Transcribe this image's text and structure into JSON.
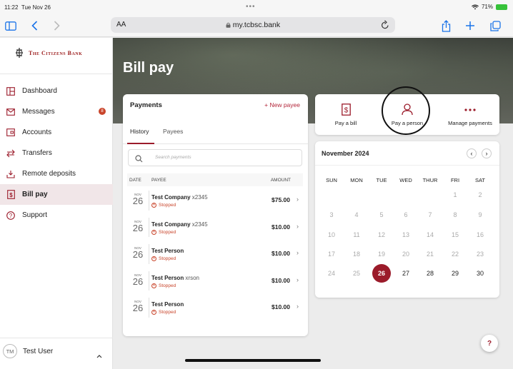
{
  "status": {
    "time": "11:22",
    "date": "Tue Nov 26",
    "battery": "71%"
  },
  "browser": {
    "text_size": "AA",
    "url": "my.tcbsc.bank"
  },
  "bank": {
    "name": "The Citizens Bank"
  },
  "sidebar": {
    "items": [
      {
        "label": "Dashboard",
        "icon": "dashboard-icon"
      },
      {
        "label": "Messages",
        "icon": "envelope-icon",
        "badge": "8"
      },
      {
        "label": "Accounts",
        "icon": "accounts-icon"
      },
      {
        "label": "Transfers",
        "icon": "transfer-icon"
      },
      {
        "label": "Remote deposits",
        "icon": "deposit-icon"
      },
      {
        "label": "Bill pay",
        "icon": "dollar-doc-icon",
        "active": true
      },
      {
        "label": "Support",
        "icon": "question-circle-icon"
      }
    ],
    "user": {
      "initials": "TM",
      "name": "Test User"
    }
  },
  "page": {
    "title": "Bill pay"
  },
  "payments": {
    "title": "Payments",
    "new_payee": "+ New payee",
    "tabs": [
      "History",
      "Payees"
    ],
    "search_placeholder": "Search payments",
    "columns": {
      "date": "DATE",
      "payee": "PAYEE",
      "amount": "AMOUNT"
    },
    "rows": [
      {
        "mon": "NOV",
        "day": "26",
        "payee": "Test Company",
        "suffix": " x2345",
        "status": "Stopped",
        "amount": "$75.00"
      },
      {
        "mon": "NOV",
        "day": "26",
        "payee": "Test Company",
        "suffix": " x2345",
        "status": "Stopped",
        "amount": "$10.00"
      },
      {
        "mon": "NOV",
        "day": "26",
        "payee": "Test Person",
        "suffix": "",
        "status": "Stopped",
        "amount": "$10.00"
      },
      {
        "mon": "NOV",
        "day": "26",
        "payee": "Test Person",
        "suffix": " xrson",
        "status": "Stopped",
        "amount": "$10.00"
      },
      {
        "mon": "NOV",
        "day": "26",
        "payee": "Test Person",
        "suffix": "",
        "status": "Stopped",
        "amount": "$10.00"
      }
    ]
  },
  "actions": {
    "pay_bill": "Pay a bill",
    "pay_person": "Pay a person",
    "manage": "Manage payments"
  },
  "calendar": {
    "title": "November 2024",
    "weekdays": [
      "SUN",
      "MON",
      "TUE",
      "WED",
      "THUR",
      "FRI",
      "SAT"
    ],
    "leading_blanks": 5,
    "days_in_month": 30,
    "today": 26
  },
  "help": {
    "label": "?"
  },
  "colors": {
    "brand": "#9b1b2a",
    "stopped": "#c9452b"
  }
}
